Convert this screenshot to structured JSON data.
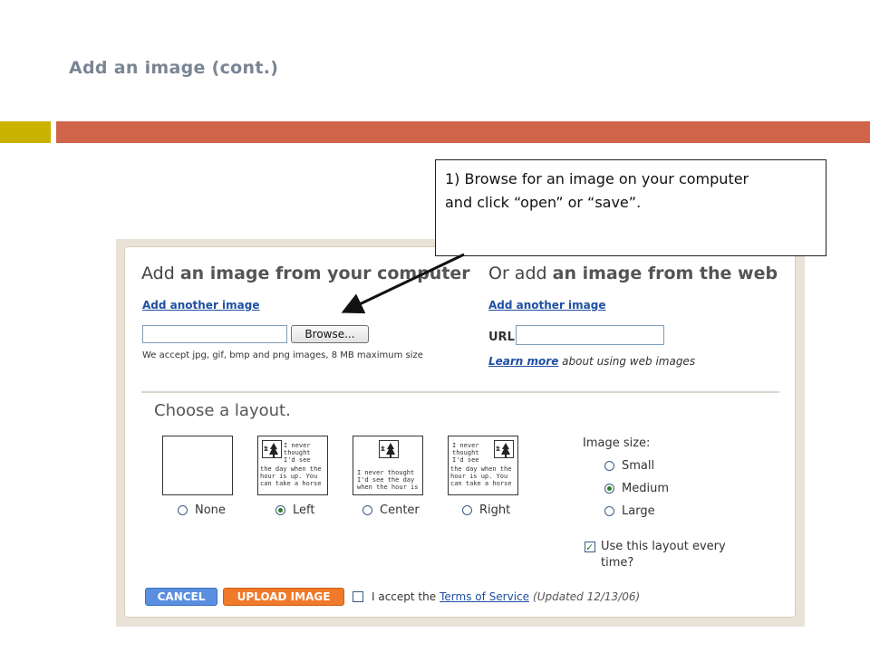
{
  "slide": {
    "title": "Add an image (cont.)"
  },
  "callout": {
    "line1": "1) Browse for an image on your computer",
    "line2": "and click “open” or “save”."
  },
  "computer": {
    "title_prefix": "Add ",
    "title_bold": "an image from your computer",
    "add_another": "Add another image",
    "browse_label": "Browse...",
    "note": "We accept jpg, gif, bmp and png images, 8 MB maximum size"
  },
  "web": {
    "title_prefix": "Or add ",
    "title_bold": "an image from the web",
    "add_another": "Add another image",
    "url_label": "URL",
    "learn_link": "Learn more",
    "learn_rest": " about using web images"
  },
  "layout": {
    "title": "Choose a layout.",
    "sample_text": {
      "right_lines": [
        "I never",
        "thought",
        "I'd see",
        "the day when the",
        "hour is up. You",
        "can take a horse"
      ],
      "center_lines": [
        "I never thought",
        "I'd see the day",
        "when the hour is"
      ]
    },
    "options": [
      {
        "label": "None",
        "selected": false
      },
      {
        "label": "Left",
        "selected": true
      },
      {
        "label": "Center",
        "selected": false
      },
      {
        "label": "Right",
        "selected": false
      }
    ]
  },
  "size": {
    "label": "Image size:",
    "options": [
      {
        "label": "Small",
        "selected": false
      },
      {
        "label": "Medium",
        "selected": true
      },
      {
        "label": "Large",
        "selected": false
      }
    ]
  },
  "use_layout": {
    "label": "Use this layout every time?",
    "checked": true
  },
  "footer": {
    "cancel": "CANCEL",
    "upload": "UPLOAD IMAGE",
    "accept_prefix": "I accept the",
    "tos_link": "Terms of Service",
    "updated": "(Updated 12/13/06)"
  },
  "colors": {
    "accent_yellow": "#c9b200",
    "accent_red": "#d0644b",
    "link_blue": "#1f4fa3",
    "cancel_blue": "#5a8fe0",
    "upload_orange": "#f07a2a"
  }
}
